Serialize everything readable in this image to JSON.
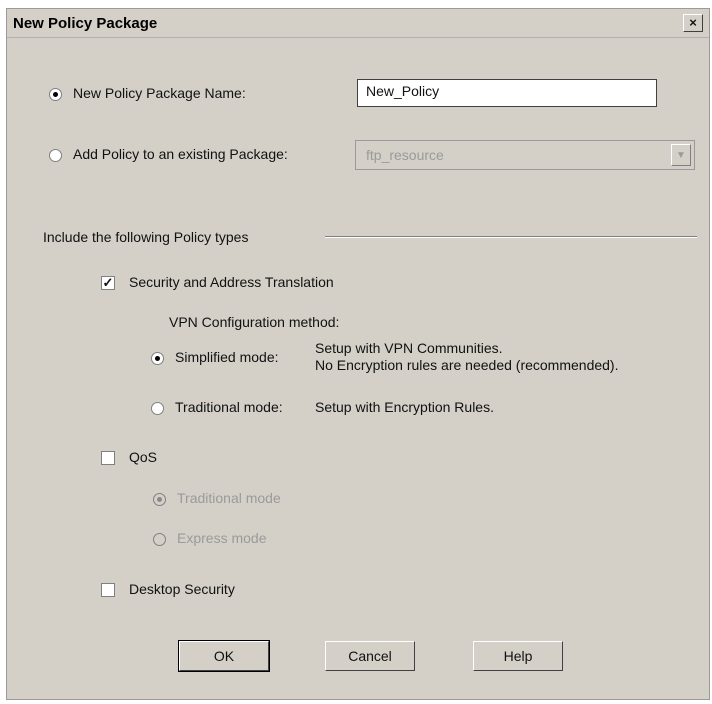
{
  "dialog": {
    "title": "New Policy Package",
    "close_glyph": "×"
  },
  "package": {
    "new_name_label": "New Policy Package Name:",
    "new_name_value": "New_Policy",
    "add_existing_label": "Add Policy to an existing Package:",
    "existing_selected": "ftp_resource",
    "selected_option": "new"
  },
  "policy_types": {
    "group_label": "Include the following Policy types",
    "security": {
      "label": "Security and Address Translation",
      "checked": true,
      "vpn_method_label": "VPN Configuration method:",
      "simplified_label": "Simplified mode:",
      "simplified_desc_1": "Setup with VPN Communities.",
      "simplified_desc_2": "No Encryption rules are needed (recommended).",
      "traditional_label": "Traditional mode:",
      "traditional_desc": "Setup with Encryption Rules.",
      "selected_mode": "simplified"
    },
    "qos": {
      "label": "QoS",
      "checked": false,
      "traditional_label": "Traditional mode",
      "express_label": "Express mode",
      "selected_mode": "traditional"
    },
    "desktop": {
      "label": "Desktop Security",
      "checked": false
    }
  },
  "buttons": {
    "ok": "OK",
    "cancel": "Cancel",
    "help": "Help"
  }
}
